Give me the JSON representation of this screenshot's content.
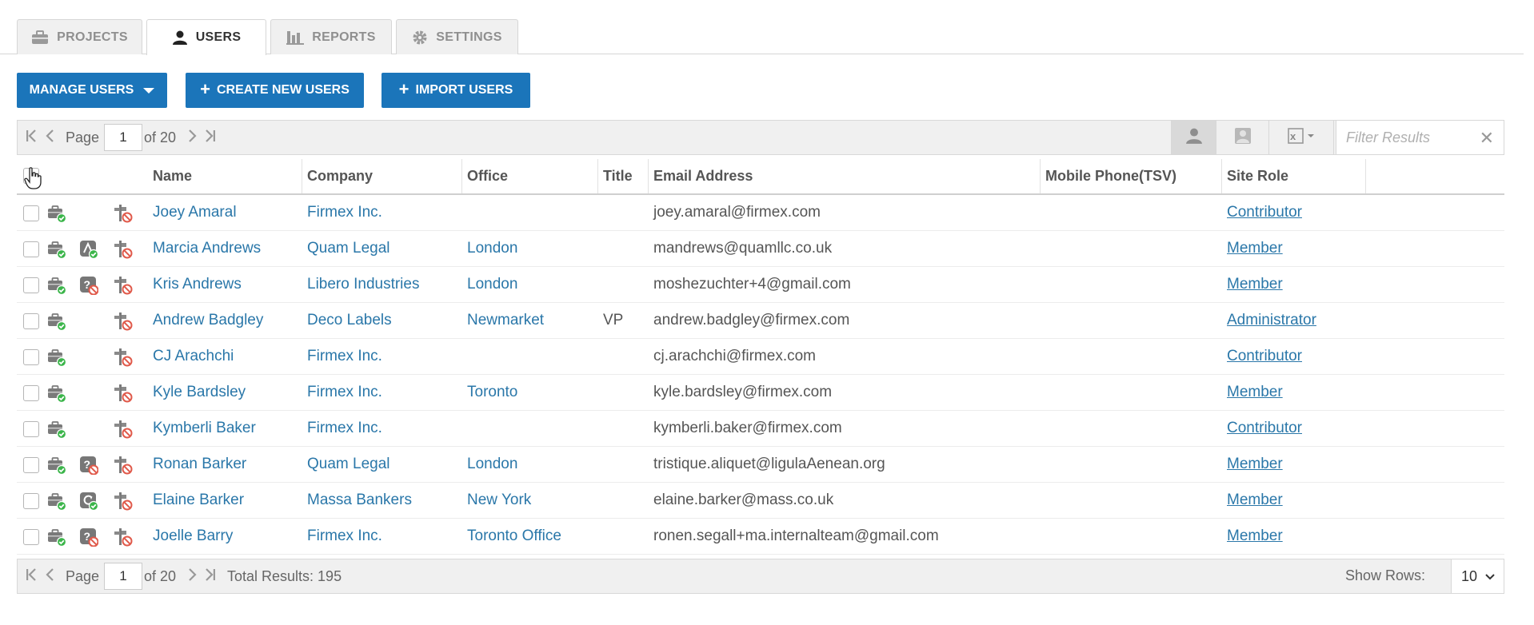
{
  "tabs": [
    {
      "label": "PROJECTS",
      "icon": "briefcase-icon"
    },
    {
      "label": "USERS",
      "icon": "user-icon",
      "active": true
    },
    {
      "label": "REPORTS",
      "icon": "bar-chart-icon"
    },
    {
      "label": "SETTINGS",
      "icon": "gear-icon"
    }
  ],
  "actions": {
    "manage_users": "MANAGE USERS",
    "create_new_users": "CREATE NEW USERS",
    "import_users": "IMPORT USERS"
  },
  "pager_top": {
    "page_label": "Page",
    "page_value": "1",
    "of_label": "of 20"
  },
  "toolbar": {
    "filter_placeholder": "Filter Results",
    "clear_symbol": "✕"
  },
  "table": {
    "headers": {
      "name": "Name",
      "company": "Company",
      "office": "Office",
      "title": "Title",
      "email": "Email Address",
      "mobile": "Mobile Phone(TSV)",
      "role": "Site Role"
    },
    "rows": [
      {
        "name": "Joey Amaral",
        "company": "Firmex Inc.",
        "office": "",
        "title": "",
        "email": "joey.amaral@firmex.com",
        "mobile": "",
        "role": "Contributor",
        "status_icon": "none"
      },
      {
        "name": "Marcia Andrews",
        "company": "Quam Legal",
        "office": "London",
        "title": "",
        "email": "mandrews@quamllc.co.uk",
        "mobile": "",
        "role": "Member",
        "status_icon": "approved"
      },
      {
        "name": "Kris Andrews",
        "company": "Libero Industries",
        "office": "London",
        "title": "",
        "email": "moshezuchter+4@gmail.com",
        "mobile": "",
        "role": "Member",
        "status_icon": "pending"
      },
      {
        "name": "Andrew Badgley",
        "company": "Deco Labels",
        "office": "Newmarket",
        "title": "VP",
        "email": "andrew.badgley@firmex.com",
        "mobile": "",
        "role": "Administrator",
        "status_icon": "none"
      },
      {
        "name": "CJ Arachchi",
        "company": "Firmex Inc.",
        "office": "",
        "title": "",
        "email": "cj.arachchi@firmex.com",
        "mobile": "",
        "role": "Contributor",
        "status_icon": "none"
      },
      {
        "name": "Kyle Bardsley",
        "company": "Firmex Inc.",
        "office": "Toronto",
        "title": "",
        "email": "kyle.bardsley@firmex.com",
        "mobile": "",
        "role": "Member",
        "status_icon": "none"
      },
      {
        "name": "Kymberli Baker",
        "company": "Firmex Inc.",
        "office": "",
        "title": "",
        "email": "kymberli.baker@firmex.com",
        "mobile": "",
        "role": "Contributor",
        "status_icon": "none"
      },
      {
        "name": "Ronan Barker",
        "company": "Quam Legal",
        "office": "London",
        "title": "",
        "email": "tristique.aliquet@ligulaAenean.org",
        "mobile": "",
        "role": "Member",
        "status_icon": "pending"
      },
      {
        "name": "Elaine Barker",
        "company": "Massa Bankers",
        "office": "New York",
        "title": "",
        "email": "elaine.barker@mass.co.uk",
        "mobile": "",
        "role": "Member",
        "status_icon": "refresh"
      },
      {
        "name": "Joelle Barry",
        "company": "Firmex Inc.",
        "office": "Toronto Office",
        "title": "",
        "email": "ronen.segall+ma.internalteam@gmail.com",
        "mobile": "",
        "role": "Member",
        "status_icon": "pending"
      }
    ]
  },
  "pager_bottom": {
    "page_label": "Page",
    "page_value": "1",
    "of_label": "of 20",
    "total_results": "Total Results: 195",
    "show_rows_label": "Show Rows:",
    "show_rows_value": "10"
  },
  "colors": {
    "primary": "#1b75ba",
    "link": "#2a77a9",
    "success_green": "#3bb54a",
    "blocked_red": "#e05a4b"
  }
}
